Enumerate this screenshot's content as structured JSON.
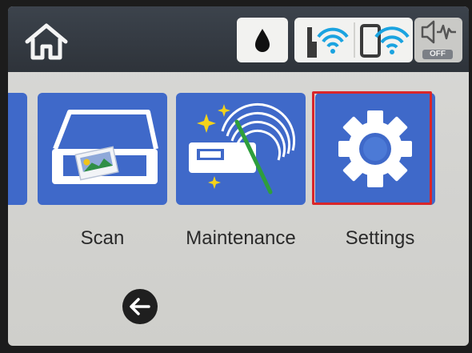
{
  "topbar": {
    "home": {
      "icon": "home-icon"
    },
    "status": [
      {
        "icon": "ink-drop-icon"
      },
      {
        "icon": "wifi-router-icon"
      },
      {
        "icon": "wifi-direct-icon"
      },
      {
        "icon": "speaker-icon",
        "badge": "OFF"
      }
    ]
  },
  "tiles": [
    {
      "label": "Scan",
      "icon": "scanner-icon"
    },
    {
      "label": "Maintenance",
      "icon": "printhead-cleaning-icon"
    },
    {
      "label": "Settings",
      "icon": "gear-icon",
      "selected": true
    }
  ],
  "nav": {
    "back_icon": "back-arrow-icon"
  },
  "colors": {
    "tile": "#3f69c9",
    "selection": "#d9262a",
    "topbar": "#353b43",
    "screen": "#d6d6d3"
  }
}
